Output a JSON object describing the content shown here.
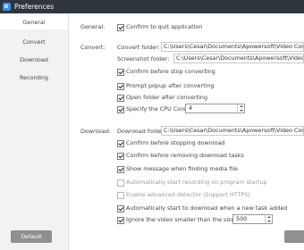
{
  "window": {
    "title": "Preferences"
  },
  "sidebar": {
    "items": [
      {
        "label": "General",
        "active": true
      },
      {
        "label": "Convert",
        "active": false
      },
      {
        "label": "Download",
        "active": false
      },
      {
        "label": "Recording",
        "active": false
      }
    ],
    "default_button": "Default"
  },
  "general": {
    "section_label": "General:",
    "confirm_quit": {
      "label": "Confirm to quit application",
      "checked": true
    }
  },
  "convert": {
    "section_label": "Convert:",
    "convert_folder_label": "Convert folder:",
    "convert_folder_value": "C:\\Users\\Cesar\\Documents\\Apowersoft\\Video Converter Studio",
    "screenshot_folder_label": "Screenshot folder:",
    "screenshot_folder_value": "C:\\Users\\Cesar\\Documents\\Apowersoft\\Video Converter Studio",
    "confirm_stop": {
      "label": "Confirm before stop converting",
      "checked": true
    },
    "prompt_popup": {
      "label": "Prompt popup after converting",
      "checked": true
    },
    "open_folder": {
      "label": "Open folder after converting",
      "checked": true
    },
    "cpu_cores": {
      "label": "Specify the CPU Cores:",
      "checked": true,
      "value": "4"
    }
  },
  "download": {
    "section_label": "Download:",
    "folder_label": "Download folder:",
    "folder_value": "C:\\Users\\Cesar\\Documents\\Apowersoft\\Video Converter Studio",
    "confirm_stop": {
      "label": "Confirm before stopping download",
      "checked": true
    },
    "confirm_remove": {
      "label": "Confirm before removing download tasks",
      "checked": true
    },
    "show_message": {
      "label": "Show message when finding media file",
      "checked": true
    },
    "auto_record": {
      "label": "Automatically start recording on program startup",
      "checked": false
    },
    "advanced_detector": {
      "label": "Enable advanced detector (Support HTTPS)",
      "checked": false
    },
    "auto_download": {
      "label": "Automatically start to download when a new task added",
      "checked": true
    },
    "ignore_small": {
      "label": "Ignore the video smaller than the size(KB):",
      "checked": true,
      "value": "500"
    }
  }
}
